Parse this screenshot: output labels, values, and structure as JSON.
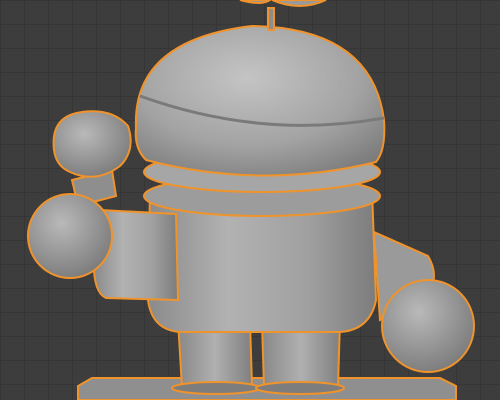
{
  "viewport": {
    "background": "#3d3d3d",
    "grid_color": "#2f2f2f",
    "selection_outline_color": "#f0932b",
    "mesh_base_color": "#9a9a9a",
    "mesh_shadow_color": "#6f6f6f",
    "mesh_highlight_color": "#c9c9c9",
    "object": "robot-figure-mesh",
    "selected": true
  }
}
